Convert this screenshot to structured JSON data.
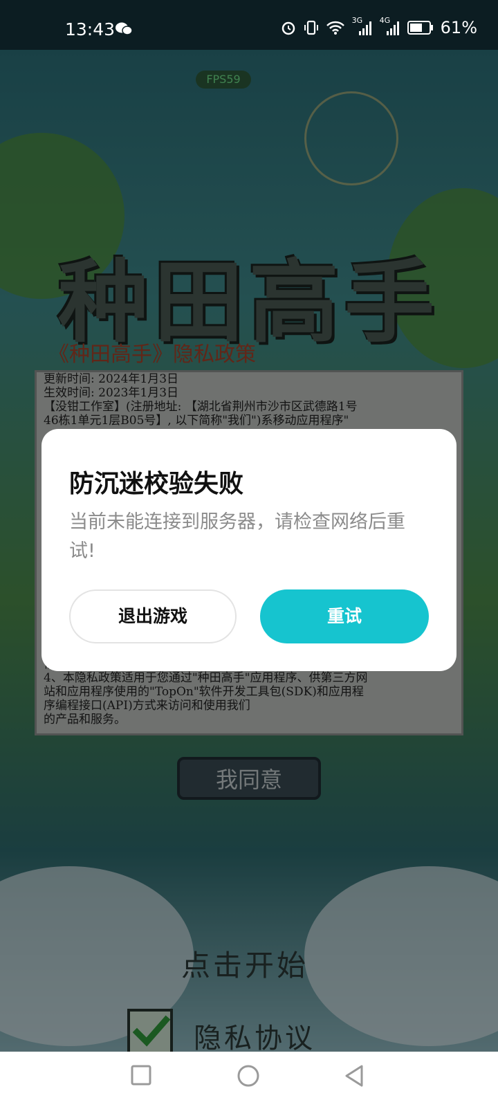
{
  "status_bar": {
    "time": "13:43",
    "network_labels": [
      "3G",
      "4G"
    ],
    "battery": "61%",
    "icons": [
      "wechat-icon",
      "alarm-icon",
      "vibrate-icon",
      "wifi-icon",
      "signal-icon",
      "battery-icon"
    ]
  },
  "game": {
    "fps": "FPS59",
    "logo_text": "种田高手",
    "policy": {
      "title": "《种田高手》隐私政策",
      "lines": [
        "更新时间: 2024年1月3日",
        "生效时间: 2023年1月3日",
        "【没钳工作室】(注册地址: 【湖北省荆州市沙市区武德路1号",
        "46栋1单元1层B05号】, 以下简称\"我们\")系移动应用程序\"",
        "信息",
        "4、本隐私政策适用于您通过\"种田高手\"应用程序、供第三方网",
        "站和应用程序使用的\"TopOn\"软件开发工具包(SDK)和应用程",
        "序编程接口(API)方式来访问和使用我们",
        "的产品和服务。"
      ]
    },
    "agree_button": "我同意",
    "tap_to_start": "点击开始",
    "privacy_label": "隐私协议"
  },
  "dialog": {
    "title": "防沉迷校验失败",
    "message": "当前未能连接到服务器，请检查网络后重试!",
    "exit_button": "退出游戏",
    "retry_button": "重试",
    "retry_color": "#16c4cf"
  },
  "nav_bar": {
    "buttons": [
      "recent-apps-icon",
      "home-icon",
      "back-icon"
    ]
  }
}
